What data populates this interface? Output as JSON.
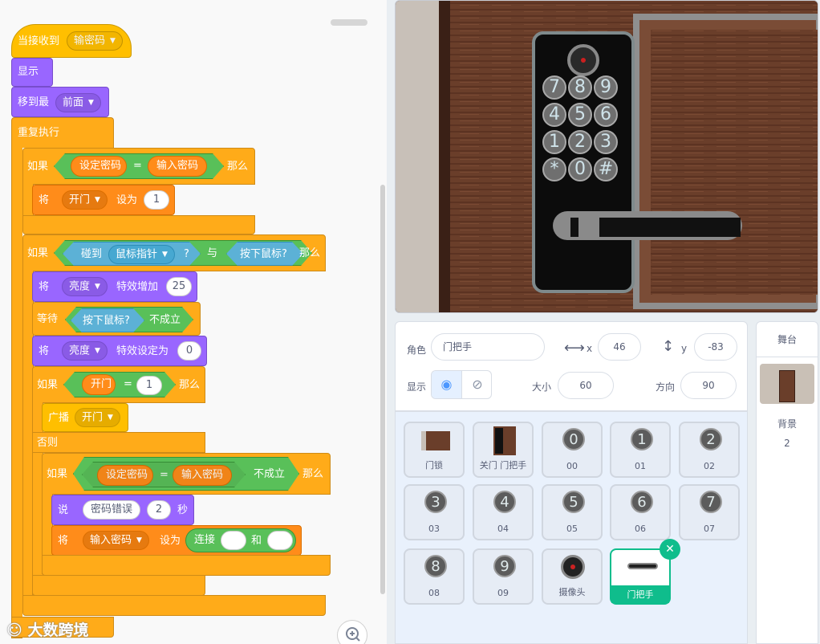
{
  "code": {
    "hat_label": "当接收到",
    "hat_message": "输密码",
    "show": "显示",
    "goto_label": "移到最",
    "goto_layer": "前面",
    "forever": "重复执行",
    "if1": {
      "if": "如果",
      "left": "设定密码",
      "eq": "=",
      "right": "输入密码",
      "then": "那么"
    },
    "set1": {
      "label": "将",
      "var": "开门",
      "to": "设为",
      "value": "1"
    },
    "if2": {
      "if": "如果",
      "touching": "碰到",
      "target": "鼠标指针",
      "q": "?",
      "and": "与",
      "mouse": "按下鼠标?",
      "then": "那么"
    },
    "change_effect": {
      "label": "将",
      "effect": "亮度",
      "action": "特效增加",
      "value": "25"
    },
    "wait": {
      "label": "等待",
      "mouse": "按下鼠标?",
      "not": "不成立"
    },
    "set_effect": {
      "label": "将",
      "effect": "亮度",
      "action": "特效设定为",
      "value": "0"
    },
    "if3": {
      "if": "如果",
      "var": "开门",
      "eq": "=",
      "value": "1",
      "then": "那么"
    },
    "broadcast": {
      "label": "广播",
      "message": "开门"
    },
    "else": "否则",
    "if4": {
      "if": "如果",
      "left": "设定密码",
      "eq": "=",
      "right": "输入密码",
      "not": "不成立",
      "then": "那么"
    },
    "say": {
      "label": "说",
      "text": "密码错误",
      "secs": "2",
      "unit": "秒"
    },
    "set2": {
      "label": "将",
      "var": "输入密码",
      "to": "设为",
      "join": "连接",
      "and": "和"
    },
    "watermark": "大数跨境"
  },
  "stage_keys": [
    "7",
    "8",
    "9",
    "4",
    "5",
    "6",
    "1",
    "2",
    "3",
    "*",
    "0",
    "#"
  ],
  "sprite_info": {
    "sprite_label": "角色",
    "sprite_name": "门把手",
    "x_label": "x",
    "x_value": "46",
    "y_label": "y",
    "y_value": "-83",
    "show_label": "显示",
    "size_label": "大小",
    "size_value": "60",
    "direction_label": "方向",
    "direction_value": "90"
  },
  "sprites": [
    {
      "name": "门锁",
      "icon": "door-lock-thumbnail"
    },
    {
      "name": "关门 门把手",
      "icon": "door-handle-closed-thumbnail"
    },
    {
      "name": "00",
      "digit": "0"
    },
    {
      "name": "01",
      "digit": "1"
    },
    {
      "name": "02",
      "digit": "2"
    },
    {
      "name": "03",
      "digit": "3"
    },
    {
      "name": "04",
      "digit": "4"
    },
    {
      "name": "05",
      "digit": "5"
    },
    {
      "name": "06",
      "digit": "6"
    },
    {
      "name": "07",
      "digit": "7"
    },
    {
      "name": "08",
      "digit": "8"
    },
    {
      "name": "09",
      "digit": "9"
    },
    {
      "name": "摄像头",
      "icon": "camera-thumbnail"
    },
    {
      "name": "门把手",
      "icon": "handle-thumbnail",
      "selected": true
    }
  ],
  "stage_panel": {
    "title": "舞台",
    "backdrops_label": "背景",
    "backdrops_count": "2"
  },
  "colors": {
    "events": "#ffbf00",
    "looks": "#9966ff",
    "control": "#ffab19",
    "variables": "#ff8c1a",
    "operators": "#59c059",
    "sensing": "#5cb1d6",
    "selected_sprite": "#0fbd8c"
  }
}
